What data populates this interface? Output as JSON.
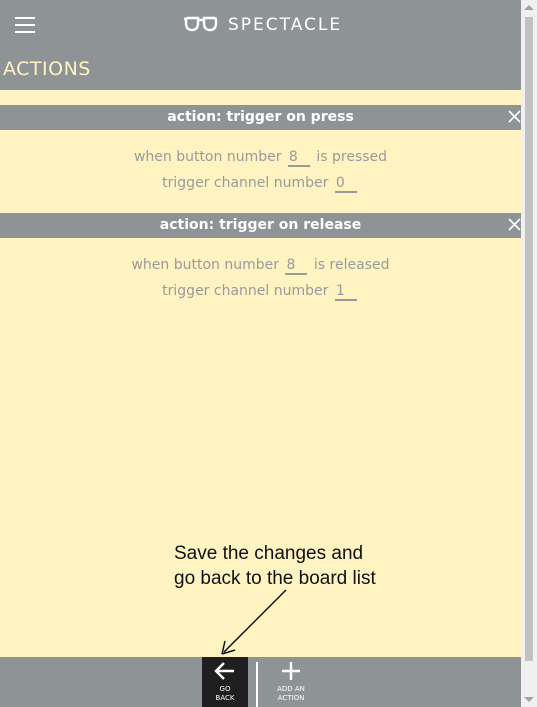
{
  "header": {
    "brand": "SPECTACLE",
    "menu_icon": "hamburger-icon",
    "logo_icon": "glasses-icon"
  },
  "page": {
    "title": "ACTIONS"
  },
  "actions": [
    {
      "title": "action: trigger on press",
      "line1_prefix": "when button number",
      "button_number": "8",
      "line1_suffix": "is pressed",
      "line2_prefix": "trigger channel number",
      "channel_number": "0"
    },
    {
      "title": "action: trigger on release",
      "line1_prefix": "when button number",
      "button_number": "8",
      "line1_suffix": "is released",
      "line2_prefix": "trigger channel number",
      "channel_number": "1"
    }
  ],
  "annotation": {
    "line1": "Save the changes and",
    "line2": "go back to the board list"
  },
  "footer": {
    "go_back_line1": "GO",
    "go_back_line2": "BACK",
    "add_line1": "ADD AN",
    "add_line2": "ACTION"
  },
  "colors": {
    "background": "#fff3c2",
    "bar": "#8e9496",
    "text_muted": "#9a9a9a",
    "go_back_bg": "#1f1f1f"
  }
}
